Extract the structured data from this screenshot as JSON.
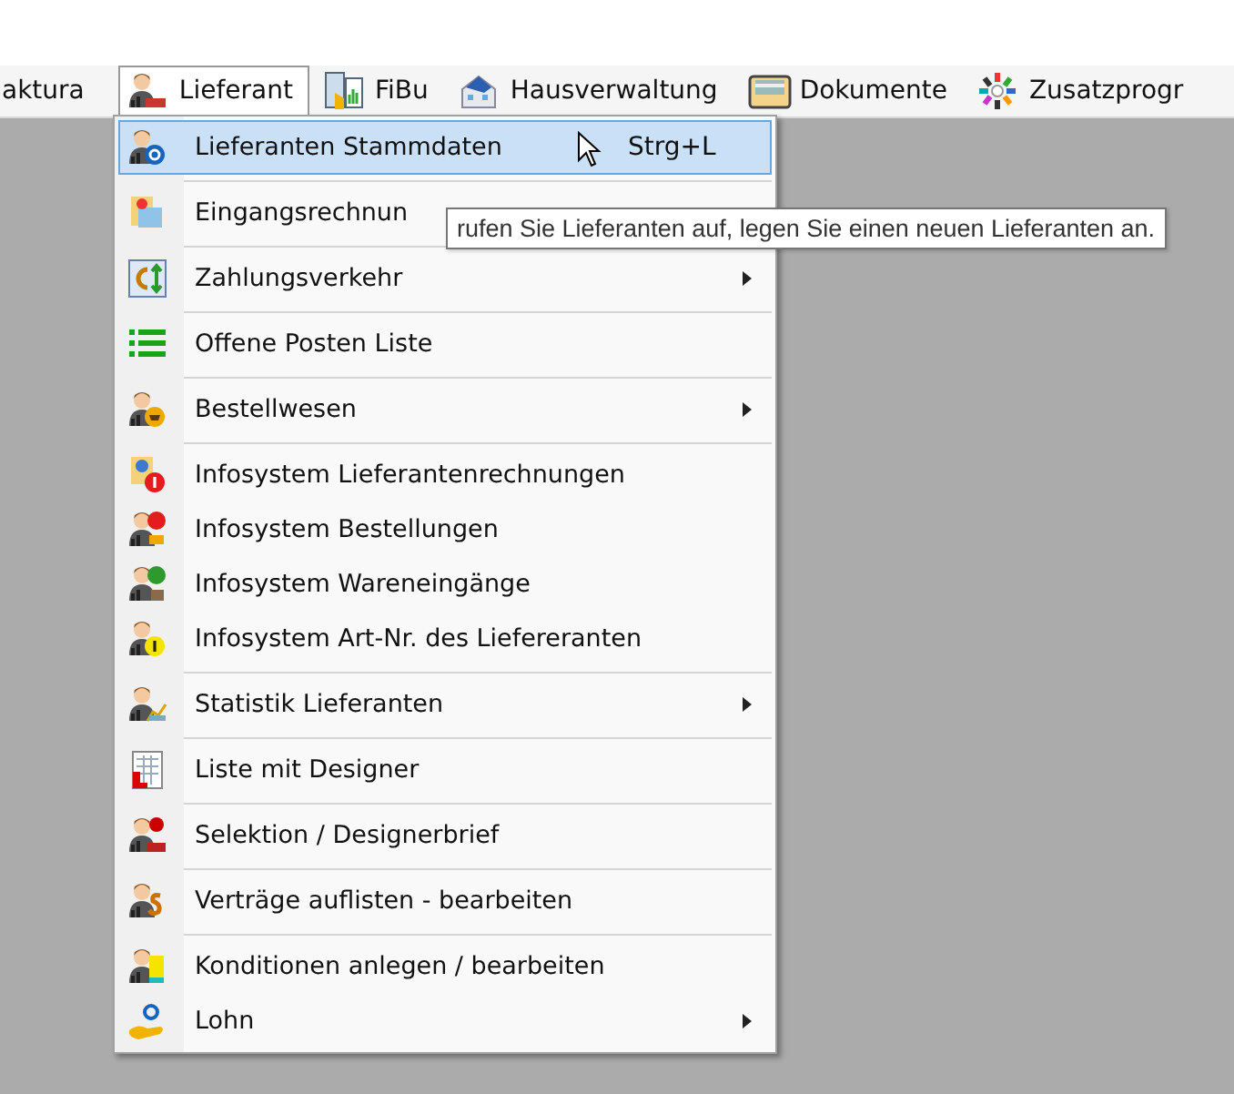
{
  "menubar": {
    "items": [
      {
        "label": "aktura",
        "selected": false
      },
      {
        "label": "Lieferant",
        "selected": true
      },
      {
        "label": "FiBu",
        "selected": false
      },
      {
        "label": "Hausverwaltung",
        "selected": false
      },
      {
        "label": "Dokumente",
        "selected": false
      },
      {
        "label": "Zusatzprogr",
        "selected": false
      }
    ]
  },
  "menu": {
    "groups": [
      [
        {
          "label": "Lieferanten Stammdaten",
          "shortcut": "Strg+L",
          "submenu": false,
          "selected": true
        }
      ],
      [
        {
          "label": "Eingangsrechnun",
          "submenu": false,
          "selected": false
        }
      ],
      [
        {
          "label": "Zahlungsverkehr",
          "submenu": true,
          "selected": false
        }
      ],
      [
        {
          "label": "Offene Posten Liste",
          "submenu": false,
          "selected": false
        }
      ],
      [
        {
          "label": "Bestellwesen",
          "submenu": true,
          "selected": false
        }
      ],
      [
        {
          "label": "Infosystem Lieferantenrechnungen",
          "submenu": false,
          "selected": false
        },
        {
          "label": "Infosystem Bestellungen",
          "submenu": false,
          "selected": false
        },
        {
          "label": "Infosystem Wareneingänge",
          "submenu": false,
          "selected": false
        },
        {
          "label": "Infosystem Art-Nr. des Liefereranten",
          "submenu": false,
          "selected": false
        }
      ],
      [
        {
          "label": "Statistik Lieferanten",
          "submenu": true,
          "selected": false
        }
      ],
      [
        {
          "label": "Liste mit Designer",
          "submenu": false,
          "selected": false
        }
      ],
      [
        {
          "label": "Selektion / Designerbrief",
          "submenu": false,
          "selected": false
        }
      ],
      [
        {
          "label": "Verträge auflisten - bearbeiten",
          "submenu": false,
          "selected": false
        }
      ],
      [
        {
          "label": "Konditionen anlegen / bearbeiten",
          "submenu": false,
          "selected": false
        },
        {
          "label": "Lohn",
          "submenu": true,
          "selected": false
        }
      ]
    ]
  },
  "tooltip": {
    "text": "rufen Sie Lieferanten auf, legen Sie einen neuen Lieferanten an."
  }
}
